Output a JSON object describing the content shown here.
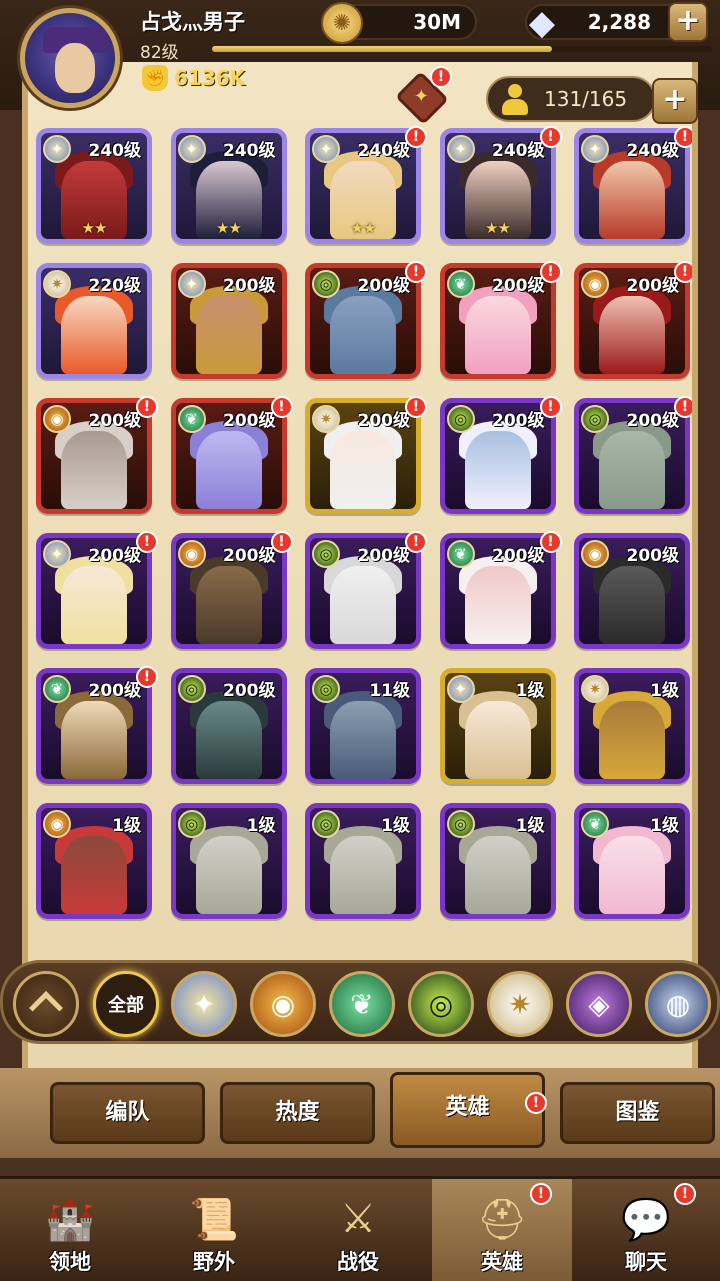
{
  "player": {
    "name": "占戈灬男子",
    "level": "82级",
    "power": "6136K",
    "xp_fraction": 0.68
  },
  "resources": {
    "gold": "30M",
    "gems": "2,288"
  },
  "roster": {
    "count": "131/165"
  },
  "heroes": [
    {
      "level": "240级",
      "faction": "lightbearer",
      "rarity": "legend",
      "stars": "★★",
      "badge": false,
      "hair": "#7a1a1a",
      "skin": "#c43a3a"
    },
    {
      "level": "240级",
      "faction": "lightbearer",
      "rarity": "legend",
      "stars": "★★",
      "badge": false,
      "hair": "#1e1e3a",
      "skin": "#d8c8d0"
    },
    {
      "level": "240级",
      "faction": "lightbearer",
      "rarity": "legend",
      "stars": "★★",
      "badge": true,
      "hair": "#e8c880",
      "skin": "#f2dac0"
    },
    {
      "level": "240级",
      "faction": "lightbearer",
      "rarity": "legend",
      "stars": "★★",
      "badge": true,
      "hair": "#3a2a2a",
      "skin": "#f0d0c0"
    },
    {
      "level": "240级",
      "faction": "lightbearer",
      "rarity": "legend",
      "stars": "",
      "badge": true,
      "hair": "#b83a2a",
      "skin": "#f0c8a8"
    },
    {
      "level": "220级",
      "faction": "celestial",
      "rarity": "legend",
      "stars": "",
      "badge": false,
      "hair": "#e85a2a",
      "skin": "#f8d8c0"
    },
    {
      "level": "200级",
      "faction": "lightbearer",
      "rarity": "mythic",
      "stars": "",
      "badge": false,
      "hair": "#c89a3a",
      "skin": "#c89070"
    },
    {
      "level": "200级",
      "faction": "graveborn",
      "rarity": "mythic",
      "stars": "",
      "badge": true,
      "hair": "#5a7aa0",
      "skin": "#8aa0c0"
    },
    {
      "level": "200级",
      "faction": "wilder",
      "rarity": "mythic",
      "stars": "",
      "badge": true,
      "hair": "#f2a0c0",
      "skin": "#fad8e0"
    },
    {
      "level": "200级",
      "faction": "mauler",
      "rarity": "mythic",
      "stars": "",
      "badge": true,
      "hair": "#9a1a1a",
      "skin": "#f0c0b0"
    },
    {
      "level": "200级",
      "faction": "mauler",
      "rarity": "mythic",
      "stars": "",
      "badge": true,
      "hair": "#d8d0c8",
      "skin": "#a89a90"
    },
    {
      "level": "200级",
      "faction": "wilder",
      "rarity": "mythic",
      "stars": "",
      "badge": true,
      "hair": "#8a80d8",
      "skin": "#c0b8f0"
    },
    {
      "level": "200级",
      "faction": "celestial",
      "rarity": "elite",
      "stars": "",
      "badge": true,
      "hair": "#f0f0f0",
      "skin": "#f8e8e0"
    },
    {
      "level": "200级",
      "faction": "graveborn",
      "rarity": "purple",
      "stars": "",
      "badge": true,
      "hair": "#f0f0ff",
      "skin": "#a8c0e0"
    },
    {
      "level": "200级",
      "faction": "graveborn",
      "rarity": "purple",
      "stars": "",
      "badge": true,
      "hair": "#8a9a8a",
      "skin": "#a8b8a8"
    },
    {
      "level": "200级",
      "faction": "lightbearer",
      "rarity": "purple",
      "stars": "",
      "badge": true,
      "hair": "#f0e0a0",
      "skin": "#f8e8d8"
    },
    {
      "level": "200级",
      "faction": "mauler",
      "rarity": "purple",
      "stars": "",
      "badge": true,
      "hair": "#4a3a2a",
      "skin": "#8a6a4a"
    },
    {
      "level": "200级",
      "faction": "graveborn",
      "rarity": "purple",
      "stars": "",
      "badge": true,
      "hair": "#d8d8d8",
      "skin": "#f0f0f0"
    },
    {
      "level": "200级",
      "faction": "wilder",
      "rarity": "purple",
      "stars": "",
      "badge": true,
      "hair": "#f8f0f0",
      "skin": "#f0c8c8"
    },
    {
      "level": "200级",
      "faction": "mauler",
      "rarity": "purple",
      "stars": "",
      "badge": false,
      "hair": "#2a2a2a",
      "skin": "#5a5a5a"
    },
    {
      "level": "200级",
      "faction": "wilder",
      "rarity": "purple",
      "stars": "",
      "badge": true,
      "hair": "#8a6a3a",
      "skin": "#f0d8b8"
    },
    {
      "level": "200级",
      "faction": "graveborn",
      "rarity": "purple",
      "stars": "",
      "badge": false,
      "hair": "#2a3a3a",
      "skin": "#6a8a8a"
    },
    {
      "level": "11级",
      "faction": "graveborn",
      "rarity": "purple",
      "stars": "",
      "badge": false,
      "hair": "#4a5a7a",
      "skin": "#8aa0b0"
    },
    {
      "level": "1级",
      "faction": "lightbearer",
      "rarity": "elite",
      "stars": "",
      "badge": false,
      "hair": "#d8c090",
      "skin": "#f8e8d8"
    },
    {
      "level": "1级",
      "faction": "celestial",
      "rarity": "purple",
      "stars": "",
      "badge": false,
      "hair": "#d8a83a",
      "skin": "#a87a3a"
    },
    {
      "level": "1级",
      "faction": "mauler",
      "rarity": "purple",
      "stars": "",
      "badge": false,
      "hair": "#c83a3a",
      "skin": "#8a4a3a"
    },
    {
      "level": "1级",
      "faction": "graveborn",
      "rarity": "purple",
      "stars": "",
      "badge": false,
      "hair": "#a8a898",
      "skin": "#d0d0c8"
    },
    {
      "level": "1级",
      "faction": "graveborn",
      "rarity": "purple",
      "stars": "",
      "badge": false,
      "hair": "#a8a898",
      "skin": "#d0d0c8"
    },
    {
      "level": "1级",
      "faction": "graveborn",
      "rarity": "purple",
      "stars": "",
      "badge": false,
      "hair": "#a8a898",
      "skin": "#d0d0c8"
    },
    {
      "level": "1级",
      "faction": "wilder",
      "rarity": "purple",
      "stars": "",
      "badge": false,
      "hair": "#f2b8d0",
      "skin": "#f8e0e8"
    }
  ],
  "filters": {
    "all_label": "全部",
    "factions": [
      "lightbearer",
      "mauler",
      "wilder",
      "graveborn",
      "celestial",
      "hypogean",
      "dimensional"
    ]
  },
  "subtabs": [
    {
      "label": "编队",
      "active": false,
      "badge": false
    },
    {
      "label": "热度",
      "active": false,
      "badge": false
    },
    {
      "label": "英雄",
      "active": true,
      "badge": true
    },
    {
      "label": "图鉴",
      "active": false,
      "badge": false
    }
  ],
  "nav": [
    {
      "label": "领地",
      "icon": "castle-icon",
      "active": false,
      "badge": false
    },
    {
      "label": "野外",
      "icon": "scroll-map-icon",
      "active": false,
      "badge": false
    },
    {
      "label": "战役",
      "icon": "sword-shield-icon",
      "active": false,
      "badge": false
    },
    {
      "label": "英雄",
      "icon": "helmet-icon",
      "active": true,
      "badge": true
    },
    {
      "label": "聊天",
      "icon": "chat-icon",
      "active": false,
      "badge": true
    }
  ],
  "badge_symbol": "!"
}
